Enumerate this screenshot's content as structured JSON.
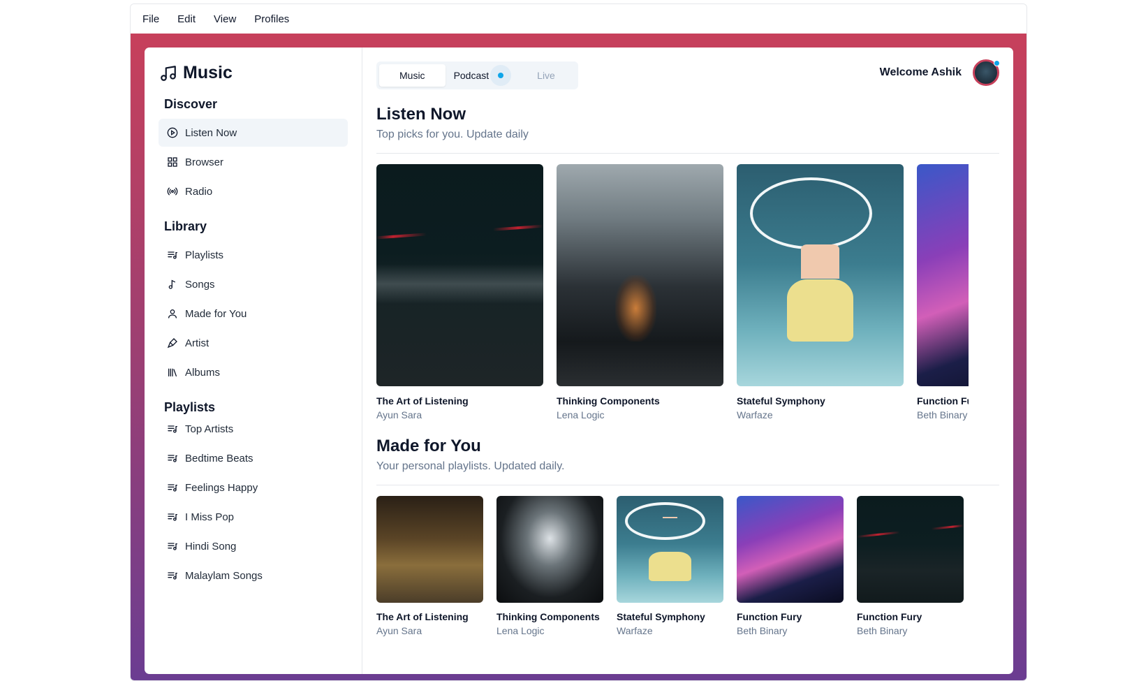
{
  "menubar": {
    "items": [
      "File",
      "Edit",
      "View",
      "Profiles"
    ]
  },
  "brand": {
    "title": "Music",
    "icon": "music-note-icon"
  },
  "sidebar": {
    "discover": {
      "title": "Discover",
      "items": [
        {
          "label": "Listen Now",
          "icon": "play-circle-icon",
          "active": true
        },
        {
          "label": "Browser",
          "icon": "grid-icon"
        },
        {
          "label": "Radio",
          "icon": "radio-icon"
        }
      ]
    },
    "library": {
      "title": "Library",
      "items": [
        {
          "label": "Playlists",
          "icon": "playlist-icon"
        },
        {
          "label": "Songs",
          "icon": "music-note-icon"
        },
        {
          "label": "Made for You",
          "icon": "user-icon"
        },
        {
          "label": "Artist",
          "icon": "microphone-icon"
        },
        {
          "label": "Albums",
          "icon": "library-icon"
        }
      ]
    },
    "playlists": {
      "title": "Playlists",
      "items": [
        {
          "label": "Top Artists"
        },
        {
          "label": "Bedtime Beats"
        },
        {
          "label": "Feelings Happy"
        },
        {
          "label": "I Miss Pop"
        },
        {
          "label": "Hindi Song"
        },
        {
          "label": "Malaylam Songs"
        }
      ]
    }
  },
  "tabs": [
    {
      "label": "Music",
      "active": true
    },
    {
      "label": "Podcast"
    },
    {
      "label": "Live",
      "disabled": true
    }
  ],
  "header": {
    "welcome": "Welcome Ashik"
  },
  "colors": {
    "accent": "#0ea5e9",
    "frame_top": "#c7405b",
    "frame_bottom": "#6a3d92"
  },
  "listen_now": {
    "title": "Listen Now",
    "subtitle": "Top picks for you. Update daily",
    "albums": [
      {
        "title": "The Art of Listening",
        "artist": "Ayun Sara"
      },
      {
        "title": "Thinking Components",
        "artist": "Lena Logic"
      },
      {
        "title": "Stateful Symphony",
        "artist": "Warfaze"
      },
      {
        "title": "Function Fury",
        "artist": "Beth Binary"
      }
    ]
  },
  "made_for_you": {
    "title": "Made for You",
    "subtitle": "Your personal playlists. Updated daily.",
    "albums": [
      {
        "title": "The Art of Listening",
        "artist": "Ayun Sara"
      },
      {
        "title": "Thinking Components",
        "artist": "Lena Logic"
      },
      {
        "title": "Stateful Symphony",
        "artist": "Warfaze"
      },
      {
        "title": "Function Fury",
        "artist": "Beth Binary"
      },
      {
        "title": "Function Fury",
        "artist": "Beth Binary"
      }
    ]
  }
}
